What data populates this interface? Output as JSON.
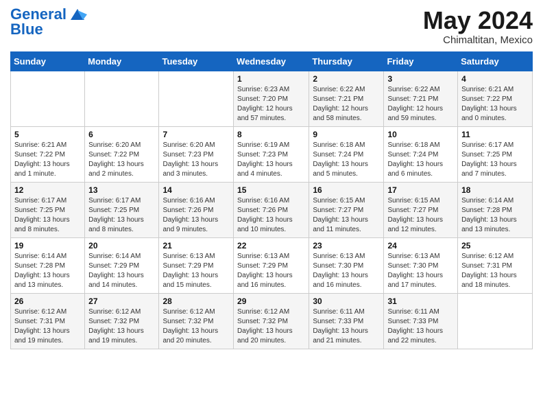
{
  "header": {
    "logo_line1": "General",
    "logo_line2": "Blue",
    "month": "May 2024",
    "location": "Chimaltitan, Mexico"
  },
  "weekdays": [
    "Sunday",
    "Monday",
    "Tuesday",
    "Wednesday",
    "Thursday",
    "Friday",
    "Saturday"
  ],
  "weeks": [
    [
      null,
      null,
      null,
      {
        "day": 1,
        "sunrise": "6:23 AM",
        "sunset": "7:20 PM",
        "daylight": "12 hours and 57 minutes."
      },
      {
        "day": 2,
        "sunrise": "6:22 AM",
        "sunset": "7:21 PM",
        "daylight": "12 hours and 58 minutes."
      },
      {
        "day": 3,
        "sunrise": "6:22 AM",
        "sunset": "7:21 PM",
        "daylight": "12 hours and 59 minutes."
      },
      {
        "day": 4,
        "sunrise": "6:21 AM",
        "sunset": "7:22 PM",
        "daylight": "13 hours and 0 minutes."
      }
    ],
    [
      {
        "day": 5,
        "sunrise": "6:21 AM",
        "sunset": "7:22 PM",
        "daylight": "13 hours and 1 minute."
      },
      {
        "day": 6,
        "sunrise": "6:20 AM",
        "sunset": "7:22 PM",
        "daylight": "13 hours and 2 minutes."
      },
      {
        "day": 7,
        "sunrise": "6:20 AM",
        "sunset": "7:23 PM",
        "daylight": "13 hours and 3 minutes."
      },
      {
        "day": 8,
        "sunrise": "6:19 AM",
        "sunset": "7:23 PM",
        "daylight": "13 hours and 4 minutes."
      },
      {
        "day": 9,
        "sunrise": "6:18 AM",
        "sunset": "7:24 PM",
        "daylight": "13 hours and 5 minutes."
      },
      {
        "day": 10,
        "sunrise": "6:18 AM",
        "sunset": "7:24 PM",
        "daylight": "13 hours and 6 minutes."
      },
      {
        "day": 11,
        "sunrise": "6:17 AM",
        "sunset": "7:25 PM",
        "daylight": "13 hours and 7 minutes."
      }
    ],
    [
      {
        "day": 12,
        "sunrise": "6:17 AM",
        "sunset": "7:25 PM",
        "daylight": "13 hours and 8 minutes."
      },
      {
        "day": 13,
        "sunrise": "6:17 AM",
        "sunset": "7:25 PM",
        "daylight": "13 hours and 8 minutes."
      },
      {
        "day": 14,
        "sunrise": "6:16 AM",
        "sunset": "7:26 PM",
        "daylight": "13 hours and 9 minutes."
      },
      {
        "day": 15,
        "sunrise": "6:16 AM",
        "sunset": "7:26 PM",
        "daylight": "13 hours and 10 minutes."
      },
      {
        "day": 16,
        "sunrise": "6:15 AM",
        "sunset": "7:27 PM",
        "daylight": "13 hours and 11 minutes."
      },
      {
        "day": 17,
        "sunrise": "6:15 AM",
        "sunset": "7:27 PM",
        "daylight": "13 hours and 12 minutes."
      },
      {
        "day": 18,
        "sunrise": "6:14 AM",
        "sunset": "7:28 PM",
        "daylight": "13 hours and 13 minutes."
      }
    ],
    [
      {
        "day": 19,
        "sunrise": "6:14 AM",
        "sunset": "7:28 PM",
        "daylight": "13 hours and 13 minutes."
      },
      {
        "day": 20,
        "sunrise": "6:14 AM",
        "sunset": "7:29 PM",
        "daylight": "13 hours and 14 minutes."
      },
      {
        "day": 21,
        "sunrise": "6:13 AM",
        "sunset": "7:29 PM",
        "daylight": "13 hours and 15 minutes."
      },
      {
        "day": 22,
        "sunrise": "6:13 AM",
        "sunset": "7:29 PM",
        "daylight": "13 hours and 16 minutes."
      },
      {
        "day": 23,
        "sunrise": "6:13 AM",
        "sunset": "7:30 PM",
        "daylight": "13 hours and 16 minutes."
      },
      {
        "day": 24,
        "sunrise": "6:13 AM",
        "sunset": "7:30 PM",
        "daylight": "13 hours and 17 minutes."
      },
      {
        "day": 25,
        "sunrise": "6:12 AM",
        "sunset": "7:31 PM",
        "daylight": "13 hours and 18 minutes."
      }
    ],
    [
      {
        "day": 26,
        "sunrise": "6:12 AM",
        "sunset": "7:31 PM",
        "daylight": "13 hours and 19 minutes."
      },
      {
        "day": 27,
        "sunrise": "6:12 AM",
        "sunset": "7:32 PM",
        "daylight": "13 hours and 19 minutes."
      },
      {
        "day": 28,
        "sunrise": "6:12 AM",
        "sunset": "7:32 PM",
        "daylight": "13 hours and 20 minutes."
      },
      {
        "day": 29,
        "sunrise": "6:12 AM",
        "sunset": "7:32 PM",
        "daylight": "13 hours and 20 minutes."
      },
      {
        "day": 30,
        "sunrise": "6:11 AM",
        "sunset": "7:33 PM",
        "daylight": "13 hours and 21 minutes."
      },
      {
        "day": 31,
        "sunrise": "6:11 AM",
        "sunset": "7:33 PM",
        "daylight": "13 hours and 22 minutes."
      },
      null
    ]
  ]
}
